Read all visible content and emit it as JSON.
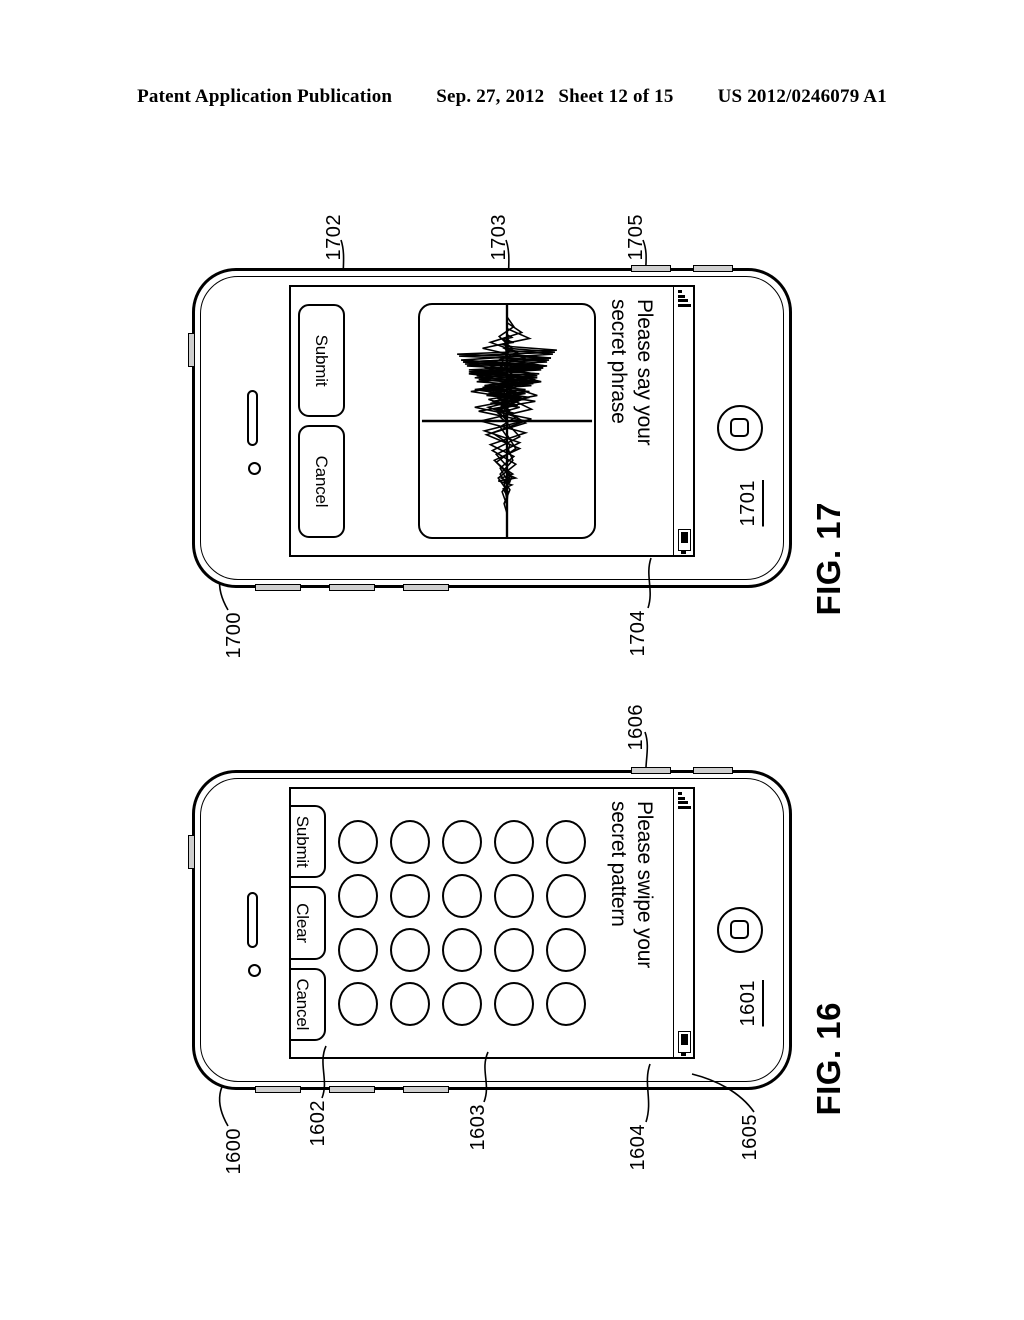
{
  "header": {
    "publication": "Patent Application Publication",
    "date": "Sep. 27, 2012",
    "sheet": "Sheet 12 of 15",
    "patent_number": "US 2012/0246079 A1"
  },
  "figures": [
    {
      "id": "fig-17",
      "caption": "FIG. 17",
      "device_ref": "1700",
      "screen_ref": "1701",
      "prompt": {
        "line1": "Please say your",
        "line2": "secret phrase",
        "ref": "1702"
      },
      "waveform": {
        "ref": "1703",
        "description": "audio-waveform"
      },
      "buttons": [
        {
          "label": "Submit",
          "ref": "1704",
          "name": "submit-button"
        },
        {
          "label": "Cancel",
          "ref": "1705",
          "name": "cancel-button"
        }
      ],
      "status_bar": {
        "signal_icon": "signal-bars-icon",
        "battery_icon": "battery-icon"
      }
    },
    {
      "id": "fig-16",
      "caption": "FIG. 16",
      "device_ref": "1600",
      "screen_ref": "1601",
      "prompt": {
        "line1": "Please swipe your",
        "line2": "secret pattern",
        "ref": "1602"
      },
      "dot_grid": {
        "ref": "1603",
        "rows": 5,
        "columns": 4,
        "total": 20
      },
      "buttons": [
        {
          "label": "Submit",
          "ref": "1604",
          "name": "submit-button"
        },
        {
          "label": "Clear",
          "ref": "1605",
          "name": "clear-button"
        },
        {
          "label": "Cancel",
          "ref": "1606",
          "name": "cancel-button"
        }
      ],
      "status_bar": {
        "signal_icon": "signal-bars-icon",
        "battery_icon": "battery-icon"
      }
    }
  ]
}
